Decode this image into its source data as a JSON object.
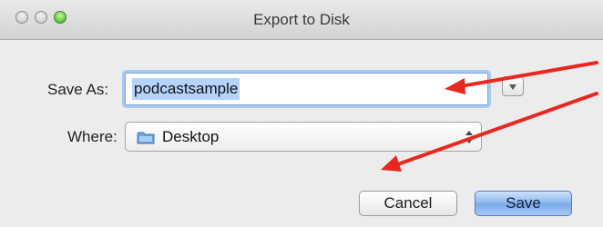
{
  "window": {
    "title": "Export to Disk"
  },
  "form": {
    "save_as_label": "Save As:",
    "save_as_value": "podcastsample",
    "where_label": "Where:",
    "where_value": "Desktop"
  },
  "buttons": {
    "cancel": "Cancel",
    "save": "Save"
  },
  "colors": {
    "annotation_arrow": "#e8281e",
    "default_button": "#78a9ea",
    "field_focus_ring": "#a9c9f0"
  },
  "icons": [
    "close-icon",
    "minimize-icon",
    "zoom-icon",
    "chevron-down-icon",
    "folder-icon",
    "up-down-arrows-icon"
  ]
}
